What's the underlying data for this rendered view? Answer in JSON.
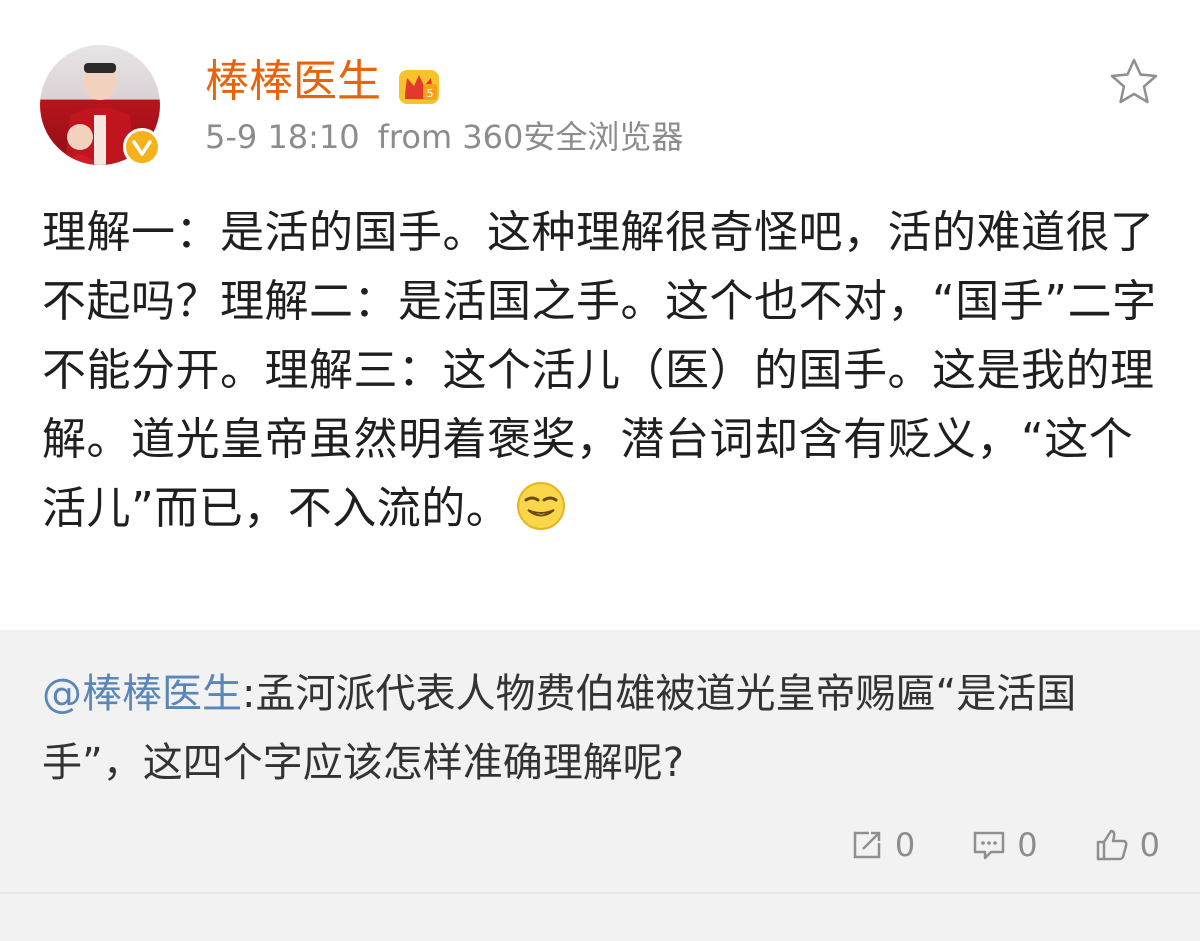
{
  "post": {
    "author": "棒棒医生",
    "time": "5-9 18:10",
    "source": "from 360安全浏览器",
    "text": "理解一：是活的国手。这种理解很奇怪吧，活的难道很了不起吗？理解二：是活国之手。这个也不对，“国手”二字不能分开。理解三：这个活儿（医）的国手。这是我的理解。道光皇帝虽然明着褒奖，潜台词却含有贬义，“这个活儿”而已，不入流的。",
    "emoji_icon": "smirk-emoji-icon",
    "badge_icon": "verified-badge-icon",
    "member_icon": "crown-member-icon",
    "favorite_icon": "star-icon"
  },
  "repost": {
    "mention": "@棒棒医生",
    "text": ":孟河派代表人物费伯雄被道光皇帝赐匾“是活国手”，这四个字应该怎样准确理解呢?"
  },
  "actions": {
    "repost_count": "0",
    "comment_count": "0",
    "like_count": "0"
  },
  "colors": {
    "author_name": "#e8640c",
    "mention": "#5a86b8",
    "meta": "#8c8c8c",
    "repost_bg": "#f2f2f2"
  }
}
